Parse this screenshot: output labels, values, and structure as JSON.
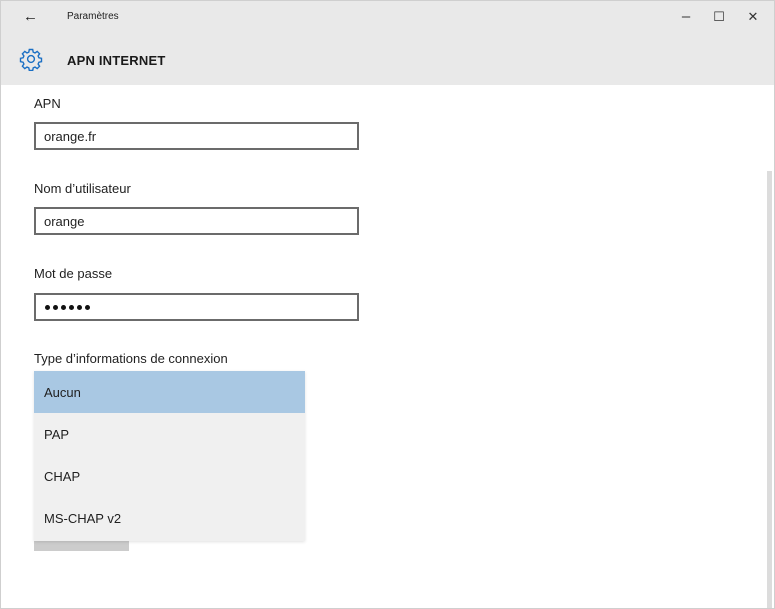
{
  "window": {
    "back_glyph": "←",
    "app_title": "Paramètres",
    "minimize_glyph": "–",
    "maximize_glyph": "☐",
    "close_glyph": "✕"
  },
  "header": {
    "icon": "gear-icon",
    "title": "APN INTERNET"
  },
  "form": {
    "apn": {
      "label": "APN",
      "value": "orange.fr"
    },
    "username": {
      "label": "Nom d’utilisateur",
      "value": "orange"
    },
    "password": {
      "label": "Mot de passe",
      "masked_length": 6
    },
    "auth_type": {
      "label": "Type d’informations de connexion",
      "selected": "Aucun",
      "options": [
        "Aucun",
        "PAP",
        "CHAP",
        "MS-CHAP v2"
      ]
    }
  },
  "colors": {
    "titlebar_bg": "#e9e9e9",
    "selected_option_bg": "#a9c8e3",
    "dropdown_bg": "#f0f0f0",
    "accent_icon": "#1a6fc4"
  }
}
